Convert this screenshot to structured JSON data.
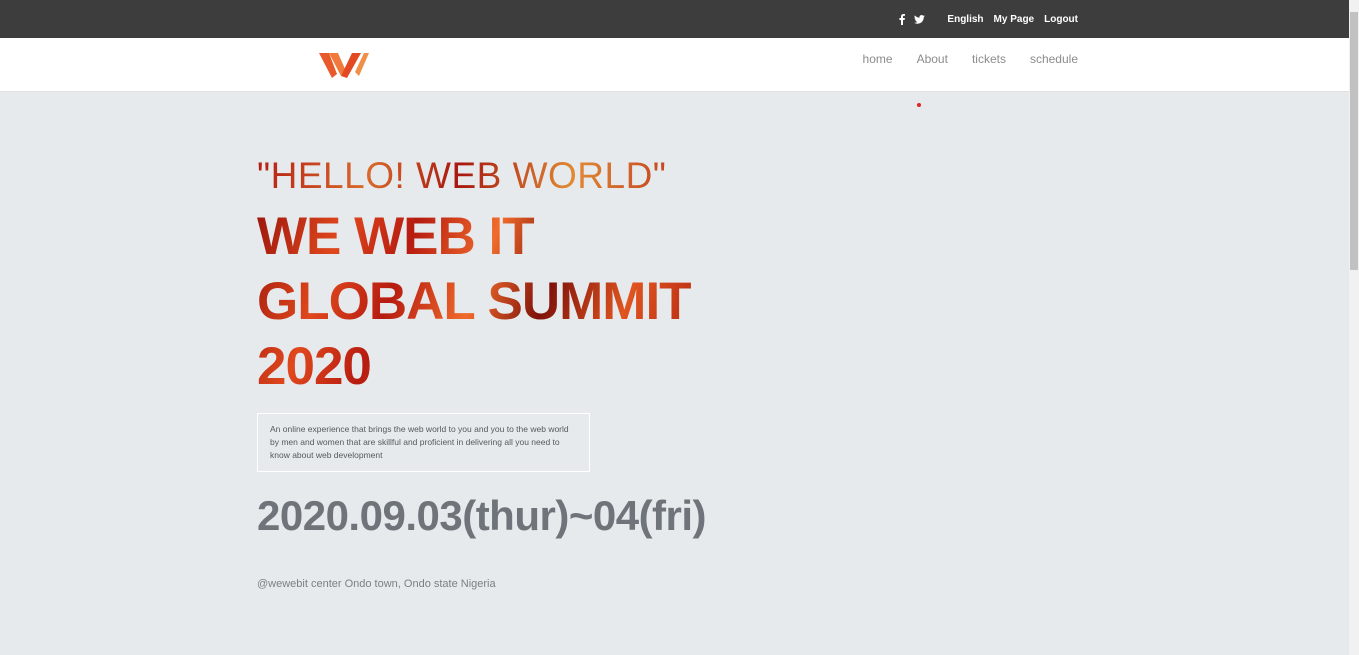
{
  "topbar": {
    "icons": [
      "facebook-icon",
      "twitter-icon"
    ],
    "language": "English",
    "my_page": "My Page",
    "logout": "Logout"
  },
  "nav": {
    "logo_icon": "ww-logo",
    "items": [
      "home",
      "About",
      "tickets",
      "schedule"
    ]
  },
  "hero": {
    "quote": "\"HELLO! WEB WORLD\"",
    "title_line1": "WE WEB IT",
    "title_line2": "GLOBAL SUMMIT",
    "title_line3": "2020",
    "description": "An online experience that brings the web world to you and you to the web world by men and women that are skillful and proficient in delivering all you need to know about web development",
    "date": "2020.09.03(thur)~04(fri)",
    "location": "@wewebit center Ondo town, Ondo state Nigeria"
  },
  "colors": {
    "topbar_bg": "#3d3d3d",
    "page_bg": "#e7eaed",
    "accent": "#e4532a"
  }
}
